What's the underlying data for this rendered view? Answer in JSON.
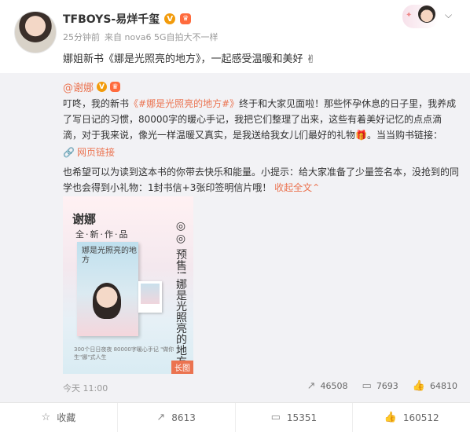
{
  "user": {
    "name": "TFBOYS-易烊千玺",
    "verified_badge": "V",
    "member_icon": "crown-icon"
  },
  "meta": {
    "time": "25分钟前",
    "source": "来自 nova6 5G自拍大不一样"
  },
  "main_text": "娜姐新书《娜是光照亮的地方》，一起感受温暖和美好",
  "repost": {
    "username": "@谢娜",
    "verified_badge": "V",
    "body_parts": [
      "叮咚，我的新书",
      "《#娜是光照亮的地方#》",
      "终于和大家见面啦！那些怀孕休息的日子里，我养成了写日记的习惯，80000字的暖心手记，我把它们整理了出来，这些有着美好记忆的点点滴滴，对于我来说，像光一样温暖又真实，是我送给我女儿们最好的礼物🎁。当当购书链接："
    ],
    "link_text": "网页链接",
    "body2": "也希望可以为读到这本书的你带去快乐和能量。小提示：给大家准备了少量签名本，没抢到的同学也会得到小礼物：1封书信+3张印签明信片哦！",
    "collapse_text": "收起全文",
    "image": {
      "title": "谢娜",
      "subtitle": "全·新·作·品",
      "cover_title": "娜是光照亮的地方",
      "vertical_title": "娜是光照亮的地方",
      "presale": "◎◎ 预售!",
      "bottom_text": "300个日日夜夜  80000字暖心手记  \"做你生\"娜\"式人生",
      "long_badge": "长图"
    },
    "time": "今天 11:00",
    "stats": {
      "reposts": "46508",
      "comments": "7693",
      "likes": "64810"
    }
  },
  "actions": {
    "favorite": "收藏",
    "repost": "8613",
    "comment": "15351",
    "like": "160512"
  }
}
